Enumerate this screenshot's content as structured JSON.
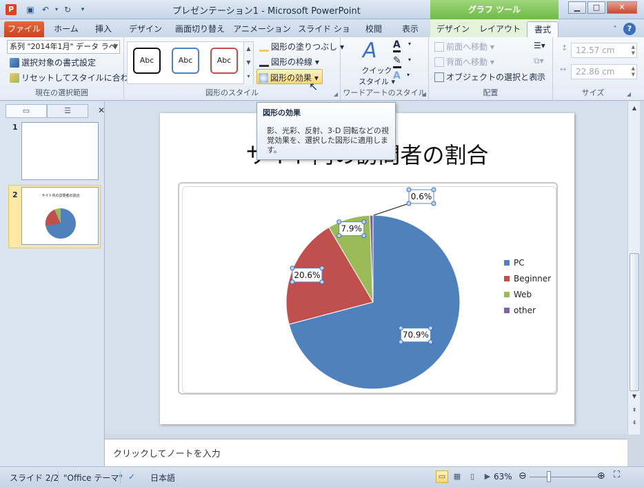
{
  "app": {
    "window_title": "プレゼンテーション1 - Microsoft PowerPoint",
    "context_tab_group": "グラフ ツール",
    "logo_letter": "P"
  },
  "tabs": [
    "ファイル",
    "ホーム",
    "挿入",
    "デザイン",
    "画面切り替え",
    "アニメーション",
    "スライド ショー",
    "校閲",
    "表示",
    "デザイン",
    "レイアウト",
    "書式"
  ],
  "ribbon": {
    "current_selection": {
      "series_value": "系列 \"2014年1月\" データ ラベ",
      "format_selection": "選択対象の書式設定",
      "reset_style": "リセットしてスタイルに合わせる",
      "label": "現在の選択範囲"
    },
    "shape_styles": {
      "thumb_label": "Abc",
      "fill": "図形の塗りつぶし",
      "outline": "図形の枠線",
      "effects": "図形の効果",
      "label": "図形のスタイル"
    },
    "wordart": {
      "quick_styles_line1": "クイック",
      "quick_styles_line2": "スタイル",
      "label": "ワードアートのスタイル"
    },
    "arrange": {
      "bring_forward": "前面へ移動",
      "send_backward": "背面へ移動",
      "selection_pane": "オブジェクトの選択と表示",
      "label": "配置"
    },
    "size": {
      "height": "12.57 cm",
      "width": "22.86 cm",
      "label": "サイズ"
    }
  },
  "tooltip": {
    "title": "図形の効果",
    "body": "影、光彩、反射、3-D 回転などの視覚効果を、選択した図形に適用します。"
  },
  "slides_panel": {
    "slide_numbers": [
      "1",
      "2"
    ],
    "thumb2_title": "サイト内の訪問者の割合"
  },
  "slide": {
    "title": "サイト内の訪問者の割合"
  },
  "chart_data": {
    "type": "pie",
    "categories": [
      "PC",
      "Beginner",
      "Web",
      "other"
    ],
    "values": [
      70.9,
      20.6,
      7.9,
      0.6
    ],
    "data_labels": [
      "70.9%",
      "20.6%",
      "7.9%",
      "0.6%"
    ],
    "colors": [
      "#4f81bd",
      "#c0504d",
      "#9bbb59",
      "#8064a2"
    ],
    "legend_position": "right"
  },
  "notes": {
    "placeholder": "クリックしてノートを入力"
  },
  "status": {
    "slide": "スライド 2/2",
    "theme": "\"Office テーマ\"",
    "language": "日本語",
    "zoom": "63%"
  }
}
